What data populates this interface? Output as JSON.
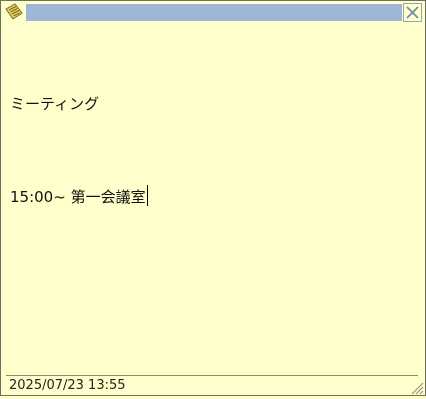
{
  "window": {
    "icon": "sticky-note-icon",
    "close_icon": "close-icon",
    "accent": "#9fb6d6",
    "background": "#ffffcc"
  },
  "note": {
    "lines": [
      "ミーティング",
      "15:00~ 第一会議室"
    ]
  },
  "footer": {
    "timestamp": "2025/07/23 13:55",
    "grip_icon": "resize-grip-icon"
  }
}
